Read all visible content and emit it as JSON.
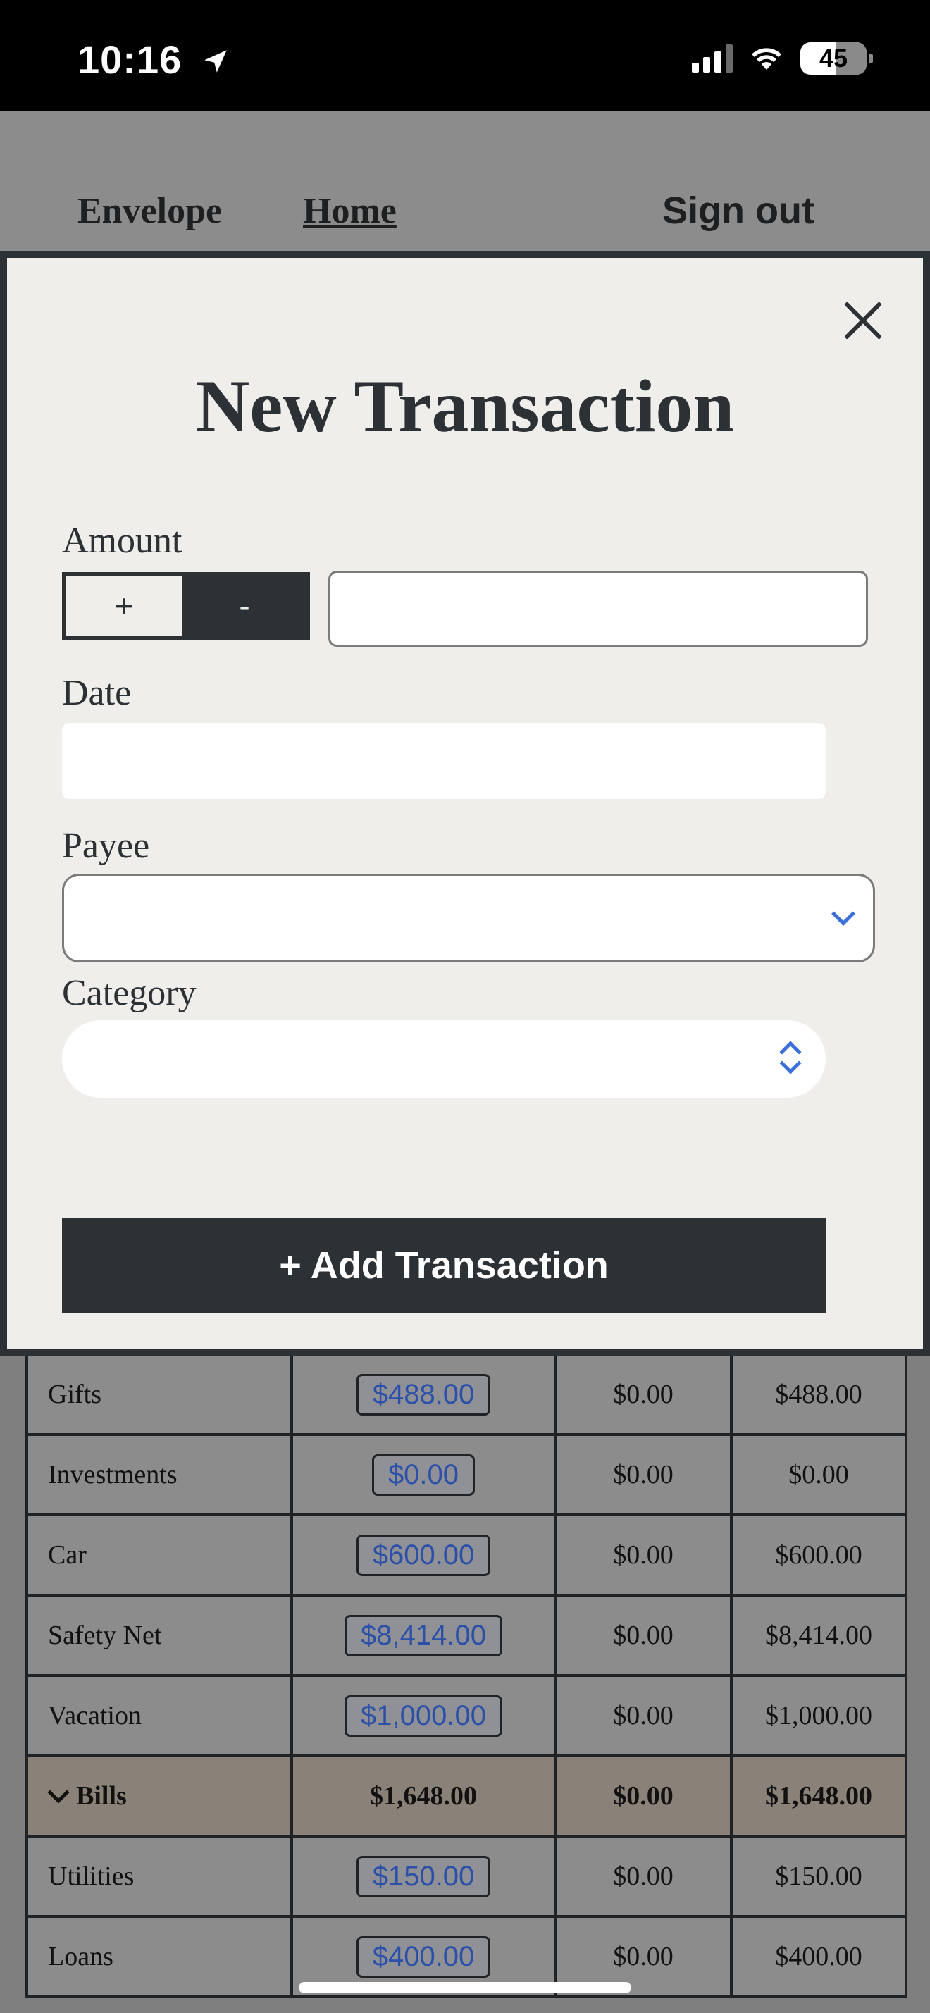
{
  "status_bar": {
    "time": "10:16",
    "battery": "45"
  },
  "header": {
    "brand": "Envelope",
    "home_link": "Home",
    "sign_out": "Sign out"
  },
  "modal": {
    "title": "New Transaction",
    "amount_label": "Amount",
    "plus_label": "+",
    "minus_label": "-",
    "amount_value": "",
    "date_label": "Date",
    "date_value": "",
    "payee_label": "Payee",
    "payee_value": "",
    "category_label": "Category",
    "category_value": "",
    "submit_label": "+ Add Transaction"
  },
  "table": {
    "rows": [
      {
        "name": "Gifts",
        "budgeted": "$488.00",
        "activity": "$0.00",
        "available": "$488.00"
      },
      {
        "name": "Investments",
        "budgeted": "$0.00",
        "activity": "$0.00",
        "available": "$0.00"
      },
      {
        "name": "Car",
        "budgeted": "$600.00",
        "activity": "$0.00",
        "available": "$600.00"
      },
      {
        "name": "Safety Net",
        "budgeted": "$8,414.00",
        "activity": "$0.00",
        "available": "$8,414.00"
      },
      {
        "name": "Vacation",
        "budgeted": "$1,000.00",
        "activity": "$0.00",
        "available": "$1,000.00"
      }
    ],
    "group": {
      "name": "Bills",
      "budgeted": "$1,648.00",
      "activity": "$0.00",
      "available": "$1,648.00"
    },
    "group_rows": [
      {
        "name": "Utilities",
        "budgeted": "$150.00",
        "activity": "$0.00",
        "available": "$150.00"
      },
      {
        "name": "Loans",
        "budgeted": "$400.00",
        "activity": "$0.00",
        "available": "$400.00"
      }
    ]
  }
}
